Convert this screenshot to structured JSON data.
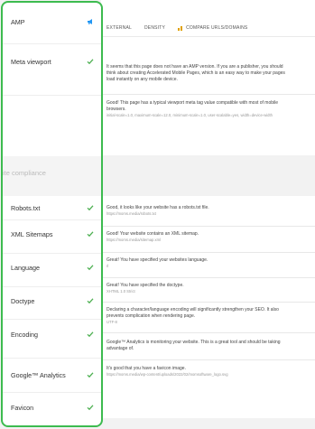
{
  "tabs": [
    {
      "label": "EXTERNAL"
    },
    {
      "label": "DENSITY"
    },
    {
      "label": "COMPARE URLS/DOMAINS"
    }
  ],
  "section_label": "ite compliance",
  "rows": [
    {
      "label": "AMP",
      "icon": "megaphone-icon"
    },
    {
      "label": "Meta viewport",
      "icon": "check-icon"
    },
    {
      "label": "Robots.txt",
      "icon": "check-icon"
    },
    {
      "label": "XML Sitemaps",
      "icon": "check-icon"
    },
    {
      "label": "Language",
      "icon": "check-icon"
    },
    {
      "label": "Doctype",
      "icon": "check-icon"
    },
    {
      "label": "Encoding",
      "icon": "check-icon"
    },
    {
      "label": "Google™ Analytics",
      "icon": "check-icon"
    },
    {
      "label": "Favicon",
      "icon": "check-icon"
    }
  ],
  "descriptions": {
    "amp": {
      "text": "It seems that this page does not have an AMP version. If you are a publisher, you should think about creating Accelerated Mobile Pages, which is an easy way to make your pages load instantly on any mobile device.",
      "sub": ""
    },
    "viewport": {
      "text": "Good! This page has a typical viewport meta tag value compatible with most of mobile browsers.",
      "sub": "initial-scale=1.0, maximum-scale=12.0, minimum-scale=1.0, user-scalable=yes, width=device-width"
    },
    "robots": {
      "text": "Good, it looks like your website has a robots.txt file.",
      "sub": "https://moms.media/robots.txt"
    },
    "sitemap": {
      "text": "Good! Your website contains an XML sitemap.",
      "sub": "https://moms.media/sitemap.xml"
    },
    "language": {
      "text": "Great! You have specified your websites language.",
      "sub": "rl"
    },
    "doctype": {
      "text": "Great! You have specified the doctype.",
      "sub": "XHTML 1.0 Strict"
    },
    "encoding": {
      "text": "Declaring a character/language encoding will significantly strengthen your SEO. It also prevents complication when rendering page.",
      "sub": "UTF-8"
    },
    "analytics": {
      "text": "Google™ Analytics is monitoring your website. This is a great tool and should be taking advantage of.",
      "sub": ""
    },
    "favicon": {
      "text": "It's good that you have a favicon image.",
      "sub": "https://moms.media/wp-content/uploads/2022/02/momsoftware_logo.svg"
    }
  },
  "colors": {
    "accent_green": "#3dbb4f",
    "check_green": "#4caf50",
    "amp_blue": "#2196f3"
  }
}
